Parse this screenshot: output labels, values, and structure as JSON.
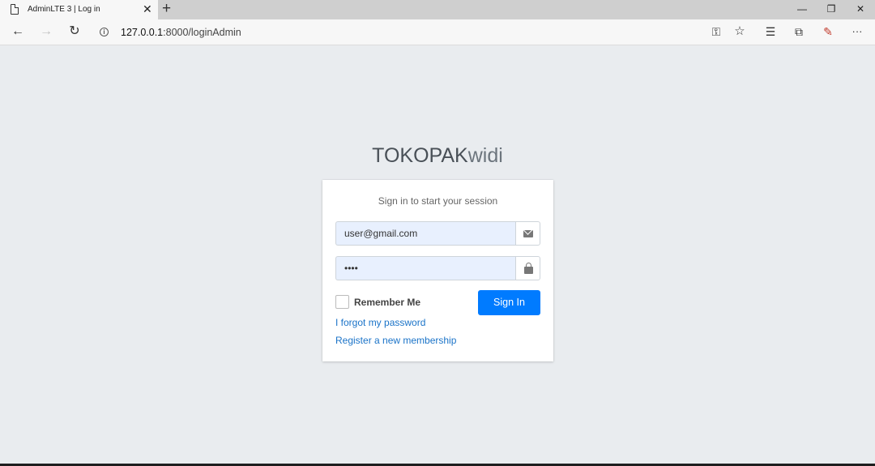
{
  "browser": {
    "tab_title": "AdminLTE 3 | Log in",
    "tab_close": "✕",
    "new_tab": "+",
    "window_controls": {
      "minimize": "—",
      "restore": "❐",
      "close": "✕"
    },
    "nav": {
      "back": "←",
      "forward": "→",
      "refresh": "↻"
    },
    "url_host": "127.0.0.1",
    "url_rest": ":8000/loginAdmin",
    "toolbar_icons": {
      "key": "key-icon",
      "favorite": "star-icon",
      "favorites": "favorites-list-icon",
      "collections": "collections-icon",
      "extension": "extension-icon",
      "more": "···"
    },
    "toolbar_glyphs": {
      "key": "⚿",
      "star": "☆",
      "favorites": "☰",
      "collections": "⧉",
      "extension": "✎"
    }
  },
  "login": {
    "logo_bold": "TOKOPAK",
    "logo_light": "widi",
    "message": "Sign in to start your session",
    "email_value": "user@gmail.com",
    "password_value": "••••",
    "remember_label": "Remember Me",
    "sign_in_label": "Sign In",
    "forgot_link": "I forgot my password",
    "register_link": "Register a new membership"
  },
  "colors": {
    "primary": "#007bff",
    "background": "#e9ecef",
    "autofill": "#e8f0fe",
    "link": "#1a73c8"
  }
}
